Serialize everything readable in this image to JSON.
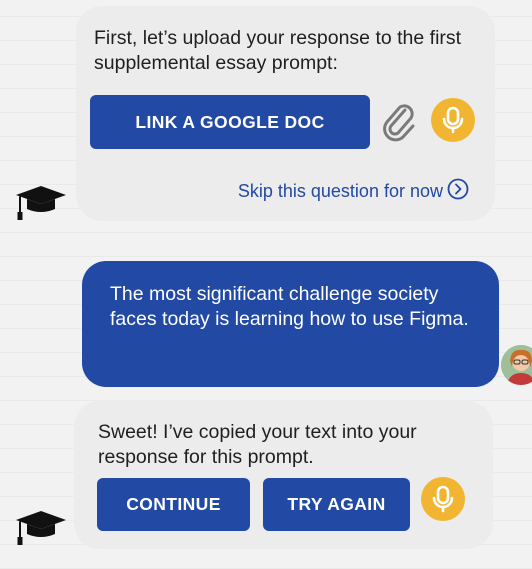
{
  "messages": {
    "bot1": {
      "text": "First, let’s upload your response to the first supplemental essay prompt:",
      "link_button": "LINK A GOOGLE DOC",
      "skip_label": "Skip this question for now"
    },
    "user1": {
      "text": "The most significant challenge society faces today is learning how to use Figma."
    },
    "bot2": {
      "text": "Sweet! I’ve copied your text into your response for this prompt.",
      "continue_button": "CONTINUE",
      "try_again_button": "TRY AGAIN"
    }
  },
  "icons": {
    "bot_avatar": "graduation-cap-icon",
    "attach": "paperclip-icon",
    "voice": "microphone-icon",
    "skip": "chevron-right-circle-icon",
    "user_avatar": "user-photo"
  },
  "colors": {
    "primary": "#2249a3",
    "bot_bubble": "#ececec",
    "mic": "#f2b531",
    "background": "#f2f2f2"
  }
}
